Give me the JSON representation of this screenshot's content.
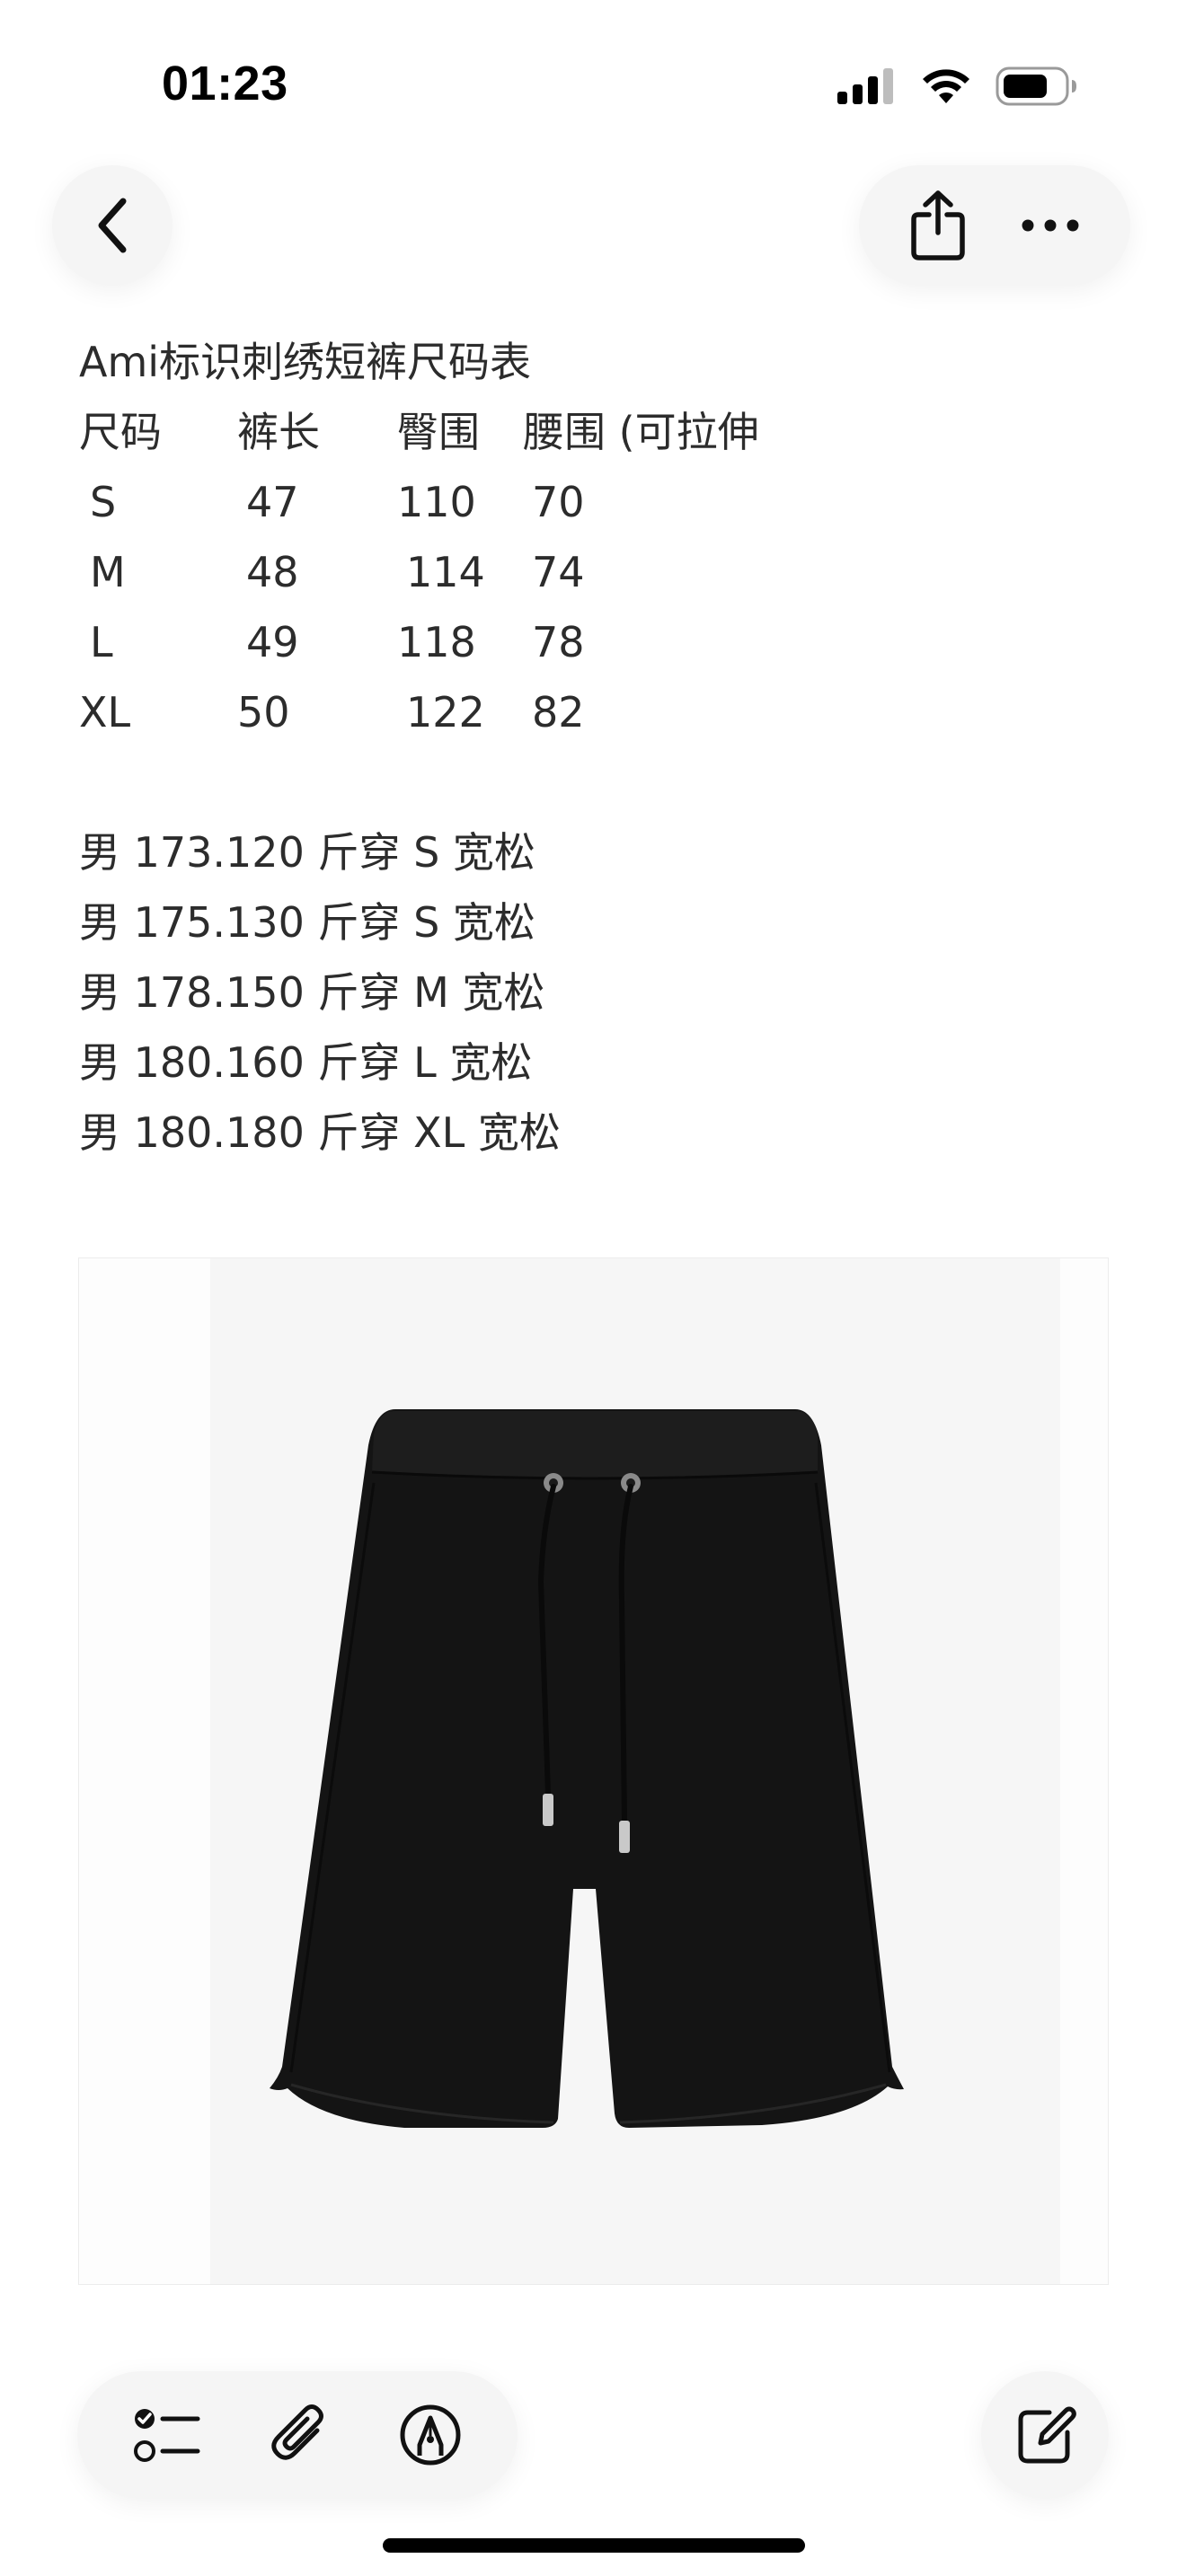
{
  "status_bar": {
    "time": "01:23"
  },
  "nav": {
    "back_icon": "chevron-left-icon",
    "share_icon": "share-icon",
    "more_icon": "ellipsis-icon"
  },
  "note": {
    "title": "Ami标识刺绣短裤尺码表",
    "table": {
      "headers": [
        "尺码",
        "裤长",
        "臀围",
        "腰围 (可拉伸"
      ],
      "rows": [
        [
          "S",
          "47",
          "110",
          "70"
        ],
        [
          "M",
          "48",
          "114",
          "74"
        ],
        [
          "L",
          "49",
          "118",
          "78"
        ],
        [
          "XL",
          "50",
          "122",
          "82"
        ]
      ]
    },
    "recommendations": [
      "男 173.120 斤穿 S 宽松",
      "男 175.130 斤穿 S 宽松",
      "男 178.150 斤穿 M 宽松",
      "男 180.160 斤穿 L 宽松",
      "男 180.180 斤穿 XL 宽松"
    ]
  },
  "image": {
    "subject": "black drawstring shorts product photo"
  },
  "toolbar": {
    "checklist_icon": "checklist-icon",
    "attachment_icon": "paperclip-icon",
    "markup_icon": "pen-tip-icon",
    "compose_icon": "compose-icon"
  },
  "colors": {
    "background": "#ffffff",
    "button_bg": "#f5f5f5",
    "text": "#2c2c2c",
    "shorts": "#141414"
  }
}
